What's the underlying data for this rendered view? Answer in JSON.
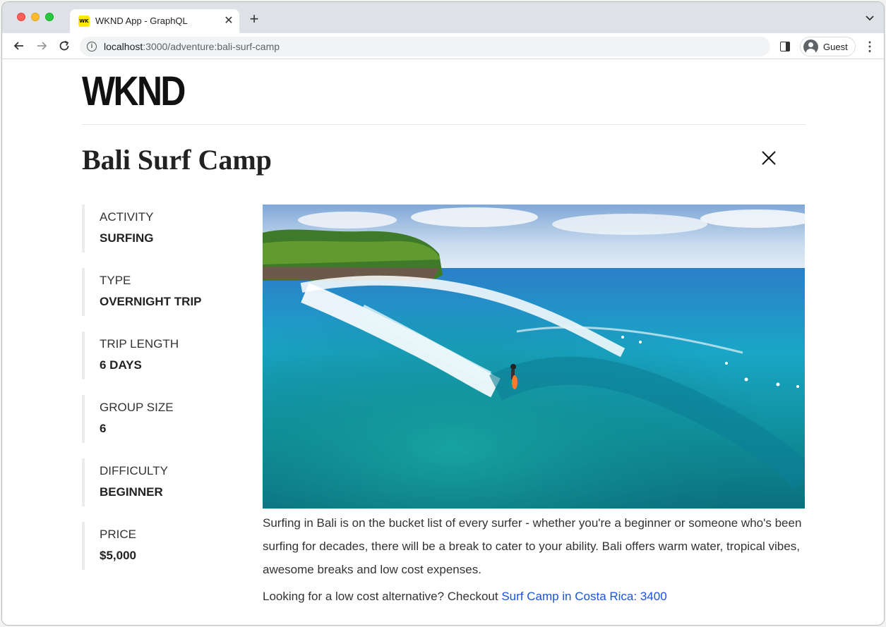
{
  "browser": {
    "tab_title": "WKND App - GraphQL",
    "tab_favicon_text": "WK",
    "url_host": "localhost",
    "url_path": ":3000/adventure:bali-surf-camp",
    "profile_label": "Guest"
  },
  "site": {
    "logo": "WKND"
  },
  "adventure": {
    "title": "Bali Surf Camp",
    "facts": [
      {
        "label": "Activity",
        "value": "Surfing"
      },
      {
        "label": "Type",
        "value": "Overnight Trip"
      },
      {
        "label": "Trip Length",
        "value": "6 Days"
      },
      {
        "label": "Group Size",
        "value": "6"
      },
      {
        "label": "Difficulty",
        "value": "Beginner"
      },
      {
        "label": "Price",
        "value": "$5,000"
      }
    ],
    "description": "Surfing in Bali is on the bucket list of every surfer - whether you're a beginner or someone who's been surfing for decades, there will be a break to cater to your ability. Bali offers warm water, tropical vibes, awesome breaks and low cost expenses.",
    "alternative_prefix": "Looking for a low cost alternative? Checkout ",
    "alternative_link": "Surf Camp in Costa Rica: 3400"
  },
  "colors": {
    "link": "#1a53e0",
    "fact_border": "#ececec"
  }
}
